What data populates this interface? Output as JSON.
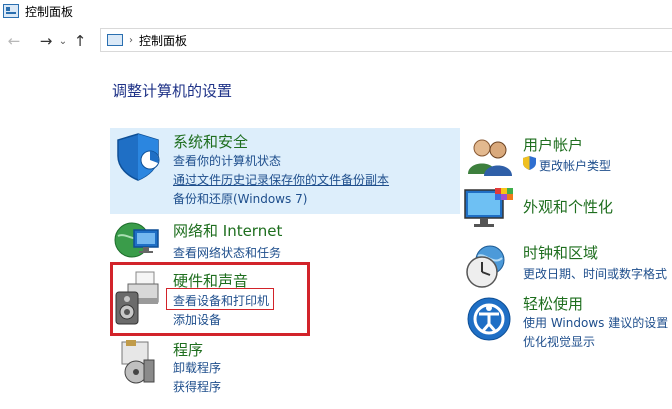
{
  "window": {
    "title": "控制面板"
  },
  "nav": {
    "back": "←",
    "forward": "→",
    "recent": "⌄",
    "up": "↑"
  },
  "address": {
    "separator": "›",
    "path": "控制面板"
  },
  "heading": "调整计算机的设置",
  "left": [
    {
      "id": "security",
      "title": "系统和安全",
      "links": [
        "查看你的计算机状态",
        "通过文件历史记录保存你的文件备份副本",
        "备份和还原(Windows 7)"
      ]
    },
    {
      "id": "network",
      "title": "网络和 Internet",
      "links": [
        "查看网络状态和任务"
      ]
    },
    {
      "id": "hardware",
      "title": "硬件和声音",
      "links": [
        "查看设备和打印机",
        "添加设备"
      ]
    },
    {
      "id": "programs",
      "title": "程序",
      "links": [
        "卸载程序",
        "获得程序"
      ]
    }
  ],
  "right": [
    {
      "id": "accounts",
      "title": "用户帐户",
      "links": [
        "更改帐户类型"
      ]
    },
    {
      "id": "appearance",
      "title": "外观和个性化",
      "links": []
    },
    {
      "id": "clock",
      "title": "时钟和区域",
      "links": [
        "更改日期、时间或数字格式"
      ]
    },
    {
      "id": "ease",
      "title": "轻松使用",
      "links": [
        "使用 Windows 建议的设置",
        "优化视觉显示"
      ]
    }
  ],
  "colors": {
    "title_green": "#1e6e1e",
    "link_blue": "#1e4e8c",
    "highlight": "#ddeefb",
    "annotation_red": "#d2232a"
  }
}
